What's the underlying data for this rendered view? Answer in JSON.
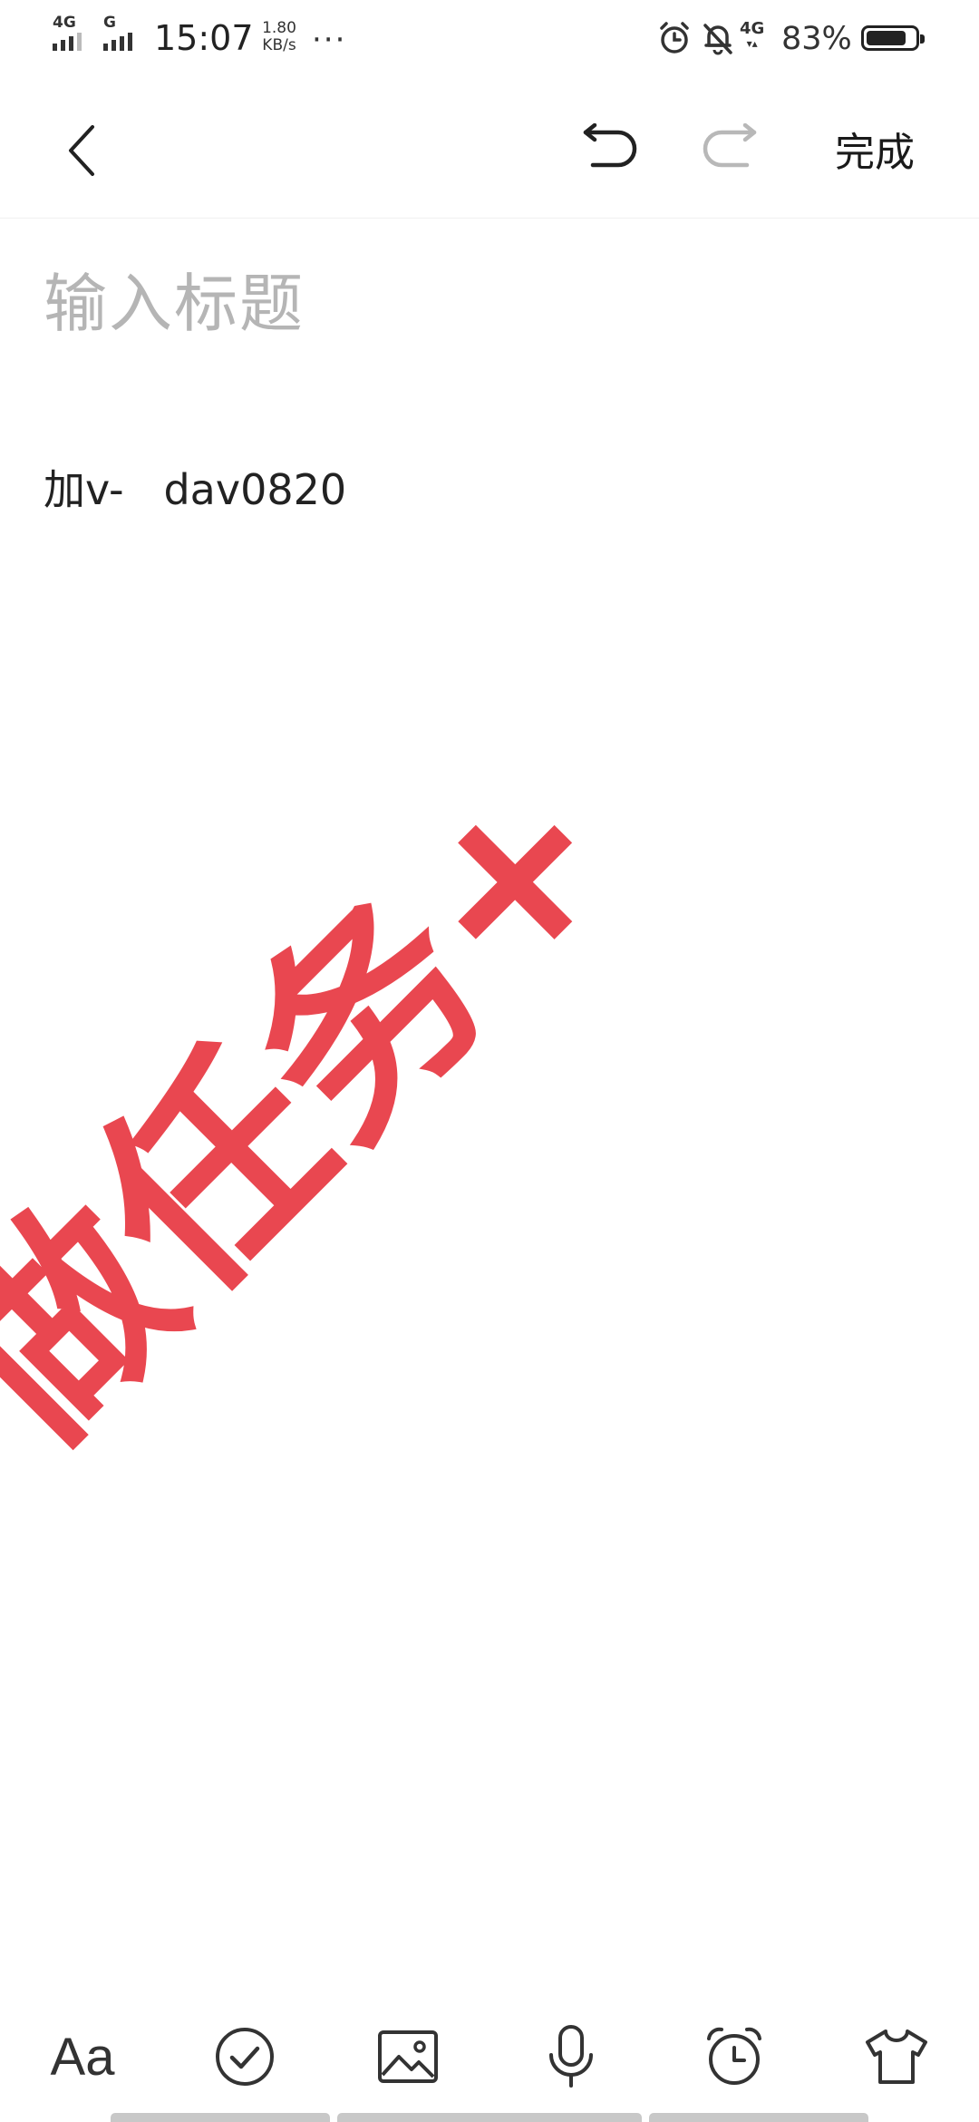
{
  "status_bar": {
    "signal_1_label": "4G",
    "signal_2_label": "G",
    "time": "15:07",
    "net_speed_value": "1.80",
    "net_speed_unit": "KB/s",
    "more": "···",
    "network_label": "4G",
    "battery_percent": "83%",
    "battery_level": 0.83
  },
  "toolbar": {
    "done_label": "完成"
  },
  "editor": {
    "title_placeholder": "输入标题",
    "body_text": "加v-   dav0820"
  },
  "watermark": {
    "text": "做任务+",
    "color": "#e62832"
  },
  "bottom_toolbar": {
    "format_label": "Aa"
  },
  "colors": {
    "text_primary": "#222222",
    "placeholder": "#b5b5b5",
    "icon_disabled": "#b8b8b8"
  }
}
